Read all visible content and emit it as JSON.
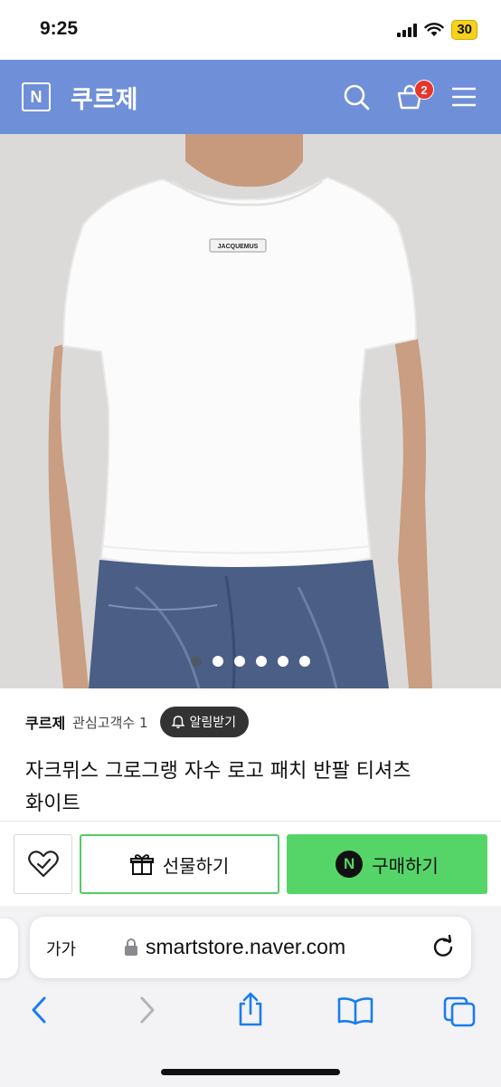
{
  "status_bar": {
    "time": "9:25",
    "battery": "30"
  },
  "header": {
    "logo_letter": "N",
    "store_name": "쿠르제",
    "cart_count": "2"
  },
  "product": {
    "patch_text": "JACQUEMUS",
    "image_dots": 6,
    "active_dot": 0
  },
  "seller": {
    "name": "쿠르제",
    "follower_text": "관심고객수 1",
    "alarm_label": "알림받기"
  },
  "title": {
    "line1": "자크뮈스 그로그랭 자수 로고 패치 반팔 티셔츠",
    "line2": "화이트"
  },
  "actions": {
    "gift_label": "선물하기",
    "buy_label": "구매하기",
    "buy_badge": "N"
  },
  "browser": {
    "text_size_label": "가가",
    "url": "smartstore.naver.com"
  },
  "colors": {
    "header_bg": "#6f8fd8",
    "buy_green": "#55d568",
    "badge_red": "#e8352b",
    "safari_blue": "#1a7cf0"
  }
}
